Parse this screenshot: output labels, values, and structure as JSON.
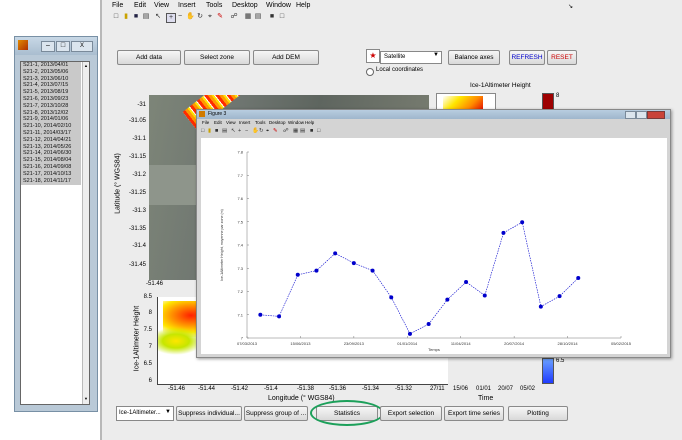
{
  "menu": [
    "File",
    "Edit",
    "View",
    "Insert",
    "Tools",
    "Desktop",
    "Window",
    "Help"
  ],
  "left_window": {
    "close_glyph": "X",
    "items": [
      "S21-1, 2013/04/01",
      "S21-2, 2013/05/06",
      "S21-3, 2013/06/10",
      "S21-4, 2013/07/15",
      "S21-5, 2013/08/19",
      "S21-6, 2013/09/23",
      "S21-7, 2013/10/28",
      "S21-8, 2013/12/02",
      "S21-9, 2014/01/06",
      "S21-10, 2014/02/10",
      "S21-11, 2014/03/17",
      "S21-12, 2014/04/21",
      "S21-13, 2014/05/26",
      "S21-14, 2014/06/30",
      "S21-15, 2014/08/04",
      "S21-16, 2014/09/08",
      "S21-17, 2014/10/13",
      "S21-18, 2014/11/17"
    ]
  },
  "toolbar_row": {
    "add_data": "Add data",
    "select_zone": "Select zone",
    "add_dem": "Add DEM",
    "dropdown_value": "Satellite",
    "balance_axes": "Balance axes",
    "refresh": "REFRESH",
    "reset": "RESET",
    "local_coords": "Local coordinates"
  },
  "main_axes": {
    "ylabel": "Latitude (° WGS84)",
    "yticks": [
      "-31",
      "-31.05",
      "-31.1",
      "-31.15",
      "-31.2",
      "-31.25",
      "-31.3",
      "-31.35",
      "-31.4",
      "-31.45"
    ],
    "xtick_visible": "-51.46",
    "colorbar_title": "Ice-1Altimeter Height",
    "colorbar_label": "8"
  },
  "bottom_axes": {
    "ylabel": "Ice-1Altimeter Height",
    "yticks": [
      "8.5",
      "8",
      "7.5",
      "7",
      "6.5",
      "6"
    ],
    "xticks": [
      "-51.46",
      "-51.44",
      "-51.42",
      "-51.4",
      "-51.38",
      "-51.36",
      "-51.34",
      "-51.32"
    ],
    "xlabel": "Longitude (° WGS84)",
    "time_ticks": [
      "27/11",
      "15/06",
      "01/01",
      "20/07",
      "05/02"
    ],
    "time_label": "Time",
    "colorbar_label": "6.5"
  },
  "bottom_buttons": {
    "select_value": "Ice-1Altimeter...",
    "suppress_individual": "Suppress individual...",
    "suppress_group": "Suppress group of ...",
    "statistics": "Statistics",
    "export_selection": "Export selection",
    "export_time_series": "Export time series",
    "plotting": "Plotting"
  },
  "figure_window": {
    "title": "Figure 3",
    "menu": [
      "File",
      "Edit",
      "View",
      "Insert",
      "Tools",
      "Desktop",
      "Window",
      "Help"
    ],
    "line_color": "#0000cc",
    "chart_data": {
      "type": "line",
      "xlabel": "Temps",
      "ylabel": "Ice-1Altimeter Height, moyenne par zone (m)",
      "xticks": [
        "07/03/2013",
        "15/06/2013",
        "23/09/2013",
        "01/01/2014",
        "11/04/2014",
        "20/07/2014",
        "28/10/2014",
        "05/02/2015"
      ],
      "yticks": [
        "7",
        "7.1",
        "7.2",
        "7.3",
        "7.4",
        "7.5",
        "7.6",
        "7.7",
        "7.8"
      ],
      "ylim": [
        7.0,
        7.8
      ],
      "x": [
        "2013-04-01",
        "2013-05-06",
        "2013-06-10",
        "2013-07-15",
        "2013-08-19",
        "2013-09-23",
        "2013-10-28",
        "2013-12-02",
        "2014-01-06",
        "2014-02-10",
        "2014-03-17",
        "2014-04-21",
        "2014-05-26",
        "2014-06-30",
        "2014-08-04",
        "2014-09-08",
        "2014-10-13",
        "2014-11-17"
      ],
      "values": [
        7.1,
        7.093,
        7.272,
        7.29,
        7.364,
        7.322,
        7.29,
        7.175,
        7.018,
        7.06,
        7.165,
        7.241,
        7.183,
        7.452,
        7.498,
        7.135,
        7.18,
        7.258
      ]
    }
  }
}
